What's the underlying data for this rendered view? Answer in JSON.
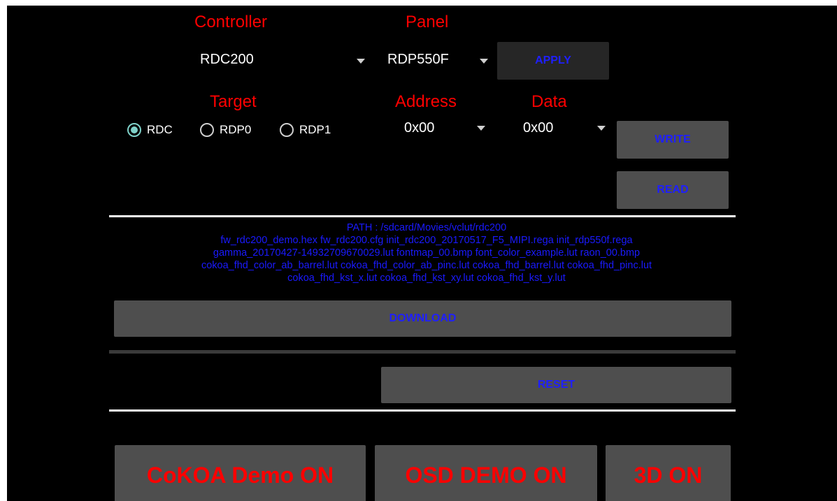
{
  "controller": {
    "label": "Controller",
    "value": "RDC200"
  },
  "panel": {
    "label": "Panel",
    "value": "RDP550F"
  },
  "apply_button": "APPLY",
  "target": {
    "label": "Target",
    "options": [
      {
        "label": "RDC",
        "checked": true
      },
      {
        "label": "RDP0",
        "checked": false
      },
      {
        "label": "RDP1",
        "checked": false
      }
    ]
  },
  "address": {
    "label": "Address",
    "value": "0x00"
  },
  "data": {
    "label": "Data",
    "value": "0x00"
  },
  "write_button": "WRITE",
  "read_button": "READ",
  "files": {
    "path": "PATH : /sdcard/Movies/vclut/rdc200",
    "line1": "fw_rdc200_demo.hex  fw_rdc200.cfg  init_rdc200_20170517_F5_MIPI.rega  init_rdp550f.rega",
    "line2": "gamma_20170427-14932709670029.lut  fontmap_00.bmp  font_color_example.lut  raon_00.bmp",
    "line3": "cokoa_fhd_color_ab_barrel.lut  cokoa_fhd_color_ab_pinc.lut  cokoa_fhd_barrel.lut  cokoa_fhd_pinc.lut",
    "line4": "cokoa_fhd_kst_x.lut  cokoa_fhd_kst_xy.lut  cokoa_fhd_kst_y.lut"
  },
  "download_button": "DOWNLOAD",
  "reset_button": "RESET",
  "demo_buttons": {
    "cokoa": "CoKOA Demo ON",
    "osd": "OSD DEMO ON",
    "three_d": "3D ON"
  },
  "colors": {
    "label_red": "#ff0000",
    "button_text_blue": "#1f1fff",
    "radio_accent": "#7fd1c9",
    "button_bg": "#4e4e4e"
  }
}
